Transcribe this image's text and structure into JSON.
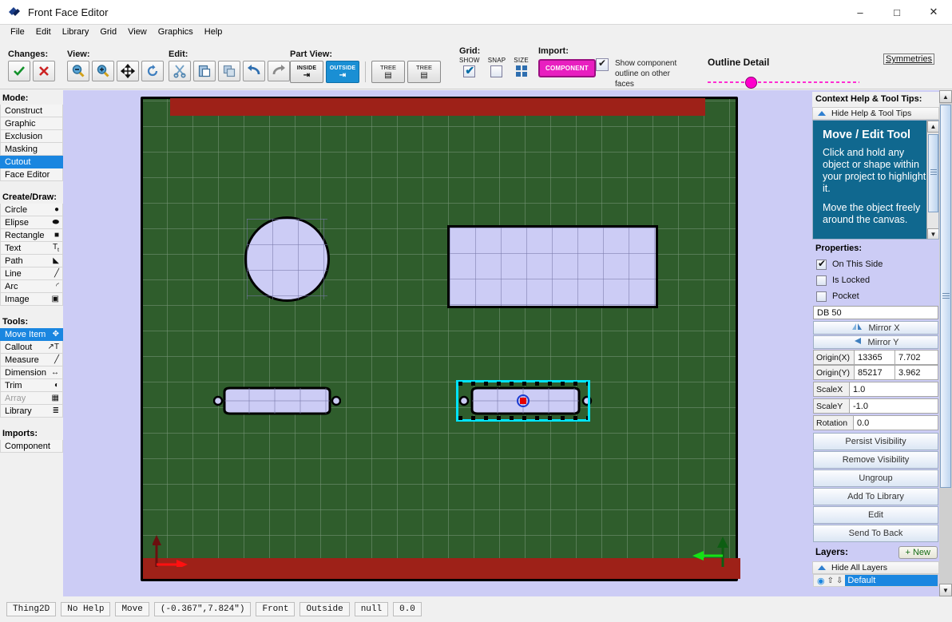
{
  "window": {
    "title": "Front Face Editor",
    "app_icon": "app-logo-icon",
    "minimize": "–",
    "maximize": "□",
    "close": "✕"
  },
  "menubar": {
    "items": [
      {
        "label": "File"
      },
      {
        "label": "Edit"
      },
      {
        "label": "Library"
      },
      {
        "label": "Grid"
      },
      {
        "label": "View"
      },
      {
        "label": "Graphics"
      },
      {
        "label": "Help"
      }
    ]
  },
  "toolbar": {
    "changes": {
      "label": "Changes:",
      "accept": "✓",
      "cancel": "✗",
      "accept_color": "#1a9a2e",
      "cancel_color": "#cc2222"
    },
    "view": {
      "label": "View:",
      "zoom_out": "zoom-out-icon",
      "zoom_in": "zoom-in-icon",
      "pan": "pan-icon",
      "refresh": "refresh-icon"
    },
    "edit": {
      "label": "Edit:",
      "cut": "scissors-icon",
      "paste": "paste-icon",
      "copy": "copy-icon",
      "undo": "undo-icon",
      "redo": "redo-icon"
    },
    "part_view": {
      "label": "Part View:",
      "inside": "INSIDE",
      "outside": "OUTSIDE",
      "active": "OUTSIDE",
      "tree1": "TREE",
      "tree2": "TREE"
    },
    "grid": {
      "label": "Grid:",
      "show_label": "SHOW",
      "snap_label": "SNAP",
      "size_label": "SIZE",
      "show_checked": true,
      "snap_checked": false
    },
    "import": {
      "label": "Import:",
      "component_button": "COMPONENT",
      "component_color": "#e81fc0",
      "outline_checked": true,
      "outline_text": "Show component outline on other faces"
    },
    "outline_detail": {
      "label": "Outline Detail",
      "value_pct": 26,
      "track_color": "#ff2ed2",
      "knob_color": "#ff00cc"
    },
    "symmetries": {
      "label": "Symmetries"
    }
  },
  "left_panel": {
    "mode": {
      "title": "Mode:",
      "items": [
        {
          "label": "Construct",
          "selected": false
        },
        {
          "label": "Graphic",
          "selected": false
        },
        {
          "label": "Exclusion",
          "selected": false
        },
        {
          "label": "Masking",
          "selected": false
        },
        {
          "label": "Cutout",
          "selected": true
        },
        {
          "label": "Face Editor",
          "selected": false
        }
      ]
    },
    "create_draw": {
      "title": "Create/Draw:",
      "items": [
        {
          "label": "Circle",
          "icon": "circle-icon",
          "glyph": "●",
          "disabled": false
        },
        {
          "label": "Elipse",
          "icon": "ellipse-icon",
          "glyph": "⬬",
          "disabled": false
        },
        {
          "label": "Rectangle",
          "icon": "rectangle-icon",
          "glyph": "■",
          "disabled": false
        },
        {
          "label": "Text",
          "icon": "text-icon",
          "glyph": "T",
          "disabled": false
        },
        {
          "label": "Path",
          "icon": "path-icon",
          "glyph": "◣",
          "disabled": false
        },
        {
          "label": "Line",
          "icon": "line-icon",
          "glyph": "╱",
          "disabled": false
        },
        {
          "label": "Arc",
          "icon": "arc-icon",
          "glyph": "◜",
          "disabled": false
        },
        {
          "label": "Image",
          "icon": "image-icon",
          "glyph": "▣",
          "disabled": false
        }
      ]
    },
    "tools": {
      "title": "Tools:",
      "items": [
        {
          "label": "Move Item",
          "icon": "move-icon",
          "glyph": "✥",
          "selected": true,
          "disabled": false
        },
        {
          "label": "Callout",
          "icon": "callout-icon",
          "glyph": "↗",
          "selected": false,
          "disabled": false
        },
        {
          "label": "Measure",
          "icon": "measure-icon",
          "glyph": "╱",
          "selected": false,
          "disabled": false
        },
        {
          "label": "Dimension",
          "icon": "dimension-icon",
          "glyph": "↔",
          "selected": false,
          "disabled": false
        },
        {
          "label": "Trim",
          "icon": "trim-icon",
          "glyph": "◐",
          "selected": false,
          "disabled": false
        },
        {
          "label": "Array",
          "icon": "array-icon",
          "glyph": "▦",
          "selected": false,
          "disabled": true
        },
        {
          "label": "Library",
          "icon": "library-icon",
          "glyph": "≣",
          "selected": false,
          "disabled": false
        }
      ]
    },
    "imports": {
      "title": "Imports:",
      "items": [
        {
          "label": "Component",
          "disabled": false
        }
      ]
    }
  },
  "canvas": {
    "board_color": "#2f5d2c",
    "band_color": "#9e2118",
    "shape_fill": "#ccccf5",
    "selection_color": "#00e5ff",
    "shapes": [
      {
        "name": "circle-cutout",
        "type": "circle"
      },
      {
        "name": "rectangle-cutout",
        "type": "rectangle"
      },
      {
        "name": "dsub-connector-left",
        "type": "dsub",
        "selected": false
      },
      {
        "name": "dsub-connector-right",
        "type": "dsub",
        "selected": true,
        "label": "DB 50"
      }
    ]
  },
  "right_panel": {
    "context_help": {
      "title": "Context Help & Tool Tips:",
      "hide_label": "Hide Help & Tool Tips",
      "tip_title": "Move / Edit Tool",
      "tip_paragraphs": [
        "Click and hold any object or shape within your project to highlight it.",
        "Move the object freely around the canvas."
      ],
      "bg_color": "#10688f"
    },
    "properties": {
      "title": "Properties:",
      "checkboxes": [
        {
          "label": "On This Side",
          "checked": true
        },
        {
          "label": "Is Locked",
          "checked": false
        },
        {
          "label": "Pocket",
          "checked": false
        }
      ],
      "name_field": "DB 50",
      "mirror_x": "Mirror X",
      "mirror_y": "Mirror Y",
      "fields": [
        {
          "label": "Origin(X)",
          "value1": "13365",
          "value2": "7.702"
        },
        {
          "label": "Origin(Y)",
          "value1": "85217",
          "value2": "3.962"
        }
      ],
      "scale_x_label": "ScaleX",
      "scale_x": "1.0",
      "scale_y_label": "ScaleY",
      "scale_y": "-1.0",
      "rotation_label": "Rotation",
      "rotation": "0.0",
      "buttons": [
        {
          "label": "Persist Visibility"
        },
        {
          "label": "Remove Visibility"
        },
        {
          "label": "Ungroup"
        },
        {
          "label": "Add To Library"
        },
        {
          "label": "Edit"
        },
        {
          "label": "Send To Back"
        }
      ]
    },
    "layers": {
      "title": "Layers:",
      "new_button": "+ New",
      "hide_all": "Hide All Layers",
      "rows": [
        {
          "name": "Default",
          "visible": true,
          "selected": true
        }
      ]
    }
  },
  "statusbar": {
    "cells": [
      {
        "name": "app-name",
        "value": "Thing2D"
      },
      {
        "name": "help-state",
        "value": "No Help"
      },
      {
        "name": "tool-state",
        "value": "Move"
      },
      {
        "name": "cursor-coords",
        "value": "(-0.367\",7.824\")"
      },
      {
        "name": "face",
        "value": "Front"
      },
      {
        "name": "side",
        "value": "Outside"
      },
      {
        "name": "selection",
        "value": "null"
      },
      {
        "name": "angle",
        "value": "0.0"
      }
    ]
  }
}
